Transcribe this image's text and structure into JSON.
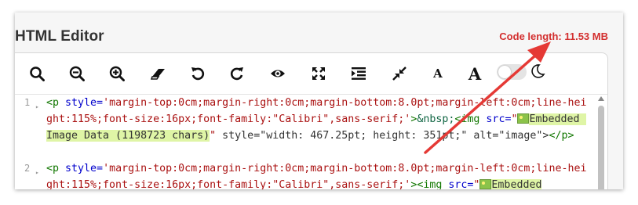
{
  "title": "HTML Editor",
  "code_length": "Code length: 11.53 MB",
  "toolbar": {
    "buttons": [
      {
        "name": "search-icon"
      },
      {
        "name": "zoom-out-icon"
      },
      {
        "name": "zoom-in-icon"
      },
      {
        "name": "eraser-icon"
      },
      {
        "name": "undo-icon"
      },
      {
        "name": "redo-icon"
      },
      {
        "name": "preview-eye-icon"
      },
      {
        "name": "expand-icon"
      },
      {
        "name": "indent-icon"
      },
      {
        "name": "compress-icon"
      },
      {
        "name": "font-decrease-icon"
      },
      {
        "name": "font-increase-icon"
      }
    ],
    "font_small_glyph": "A",
    "font_large_glyph": "A"
  },
  "code": {
    "lines": [
      {
        "number": "1",
        "tag_open": "<p",
        "style_attr": " style=",
        "style_value": "'margin-top:0cm;margin-right:0cm;margin-bottom:8.0pt;margin-left:0cm;line-height:115%;font-size:16px;font-family:\"Calibri\",sans-serif;'",
        "gt": ">",
        "entity": "&nbsp;",
        "img_tag": "<img",
        "src_attr": " src=",
        "quote_open": "\"",
        "embedded_label": "Embedded Image Data (1198723 chars)",
        "quote_close": "\"",
        "rest": " style=\"width: 467.25pt; height: 351pt;\" alt=\"image\">",
        "close_tag": "</p>"
      },
      {
        "number": "2",
        "tag_open": "<p",
        "style_attr": " style=",
        "style_value": "'margin-top:0cm;margin-right:0cm;margin-bottom:8.0pt;margin-left:0cm;line-height:115%;font-size:16px;font-family:\"Calibri\",sans-serif;'",
        "gt": ">",
        "img_tag": "<img",
        "src_attr": " src=",
        "quote_open": "\"",
        "embedded_label": "Embedded"
      }
    ]
  },
  "colors": {
    "accent_red": "#d32f2f",
    "tag_green": "#117700",
    "attr_blue": "#0000cc",
    "string_red": "#aa1111",
    "highlight": "#dff5a6"
  }
}
